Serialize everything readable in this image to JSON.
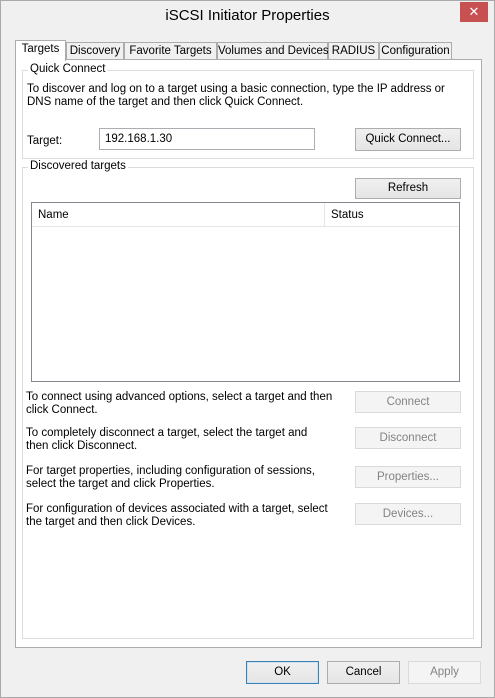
{
  "window": {
    "title": "iSCSI Initiator Properties",
    "close_glyph": "✕"
  },
  "tabs": [
    {
      "label": "Targets"
    },
    {
      "label": "Discovery"
    },
    {
      "label": "Favorite Targets"
    },
    {
      "label": "Volumes and Devices"
    },
    {
      "label": "RADIUS"
    },
    {
      "label": "Configuration"
    }
  ],
  "quick_connect": {
    "legend": "Quick Connect",
    "description_line1": "To discover and log on to a target using a basic connection, type the IP address or",
    "description_line2": "DNS name of the target and then click Quick Connect.",
    "target_label": "Target:",
    "target_value": "192.168.1.30",
    "button_label": "Quick Connect..."
  },
  "discovered": {
    "legend": "Discovered targets",
    "refresh_label": "Refresh",
    "columns": [
      "Name",
      "Status"
    ],
    "rows": []
  },
  "actions": [
    {
      "line1": "To connect using advanced options, select a target and then",
      "line2": "click Connect.",
      "button": "Connect"
    },
    {
      "line1": "To completely disconnect a target, select the target and",
      "line2": "then click Disconnect.",
      "button": "Disconnect"
    },
    {
      "line1": "For target properties, including configuration of sessions,",
      "line2": "select the target and click Properties.",
      "button": "Properties..."
    },
    {
      "line1": "For configuration of devices associated with a target, select",
      "line2": "the target and then click Devices.",
      "button": "Devices..."
    }
  ],
  "footer": {
    "ok_label": "OK",
    "cancel_label": "Cancel",
    "apply_label": "Apply"
  }
}
